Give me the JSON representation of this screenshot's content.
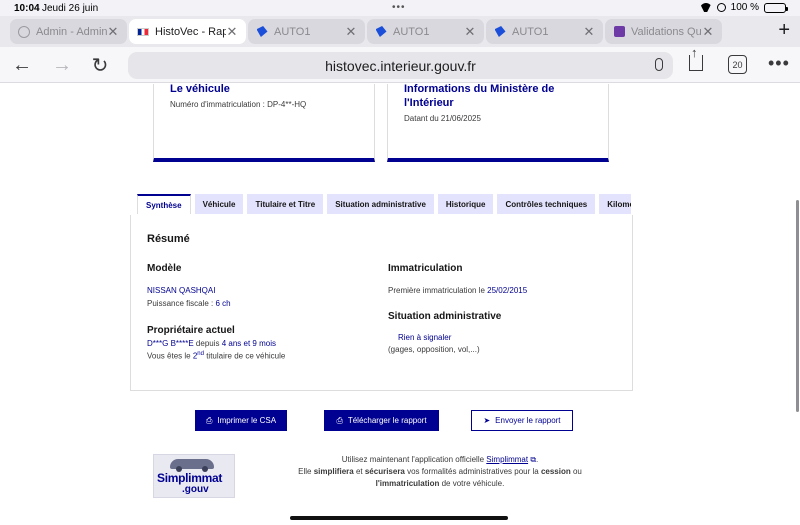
{
  "status_bar": {
    "time": "10:04",
    "date": "Jeudi 26 juin",
    "battery": "100 %"
  },
  "browser": {
    "tabs": [
      {
        "title": "Admin - Admin",
        "icon": "globe-icon",
        "active": false
      },
      {
        "title": "HistoVec - Rap",
        "icon": "french-flag-icon",
        "active": true
      },
      {
        "title": "AUTO1",
        "icon": "auto1-icon",
        "active": false
      },
      {
        "title": "AUTO1",
        "icon": "auto1-icon",
        "active": false
      },
      {
        "title": "AUTO1",
        "icon": "auto1-icon",
        "active": false
      },
      {
        "title": "Validations Qu",
        "icon": "validations-icon",
        "active": false
      }
    ],
    "url": "histovec.interieur.gouv.fr",
    "tab_count": "20"
  },
  "cards": {
    "vehicle": {
      "title": "Le véhicule",
      "line": "Numéro d'immatriculation : DP-4**-HQ"
    },
    "ministry": {
      "title_1": "Informations du Ministère de",
      "title_2": "l'Intérieur",
      "line": "Datant du 21/06/2025"
    }
  },
  "report_tabs": [
    "Synthèse",
    "Véhicule",
    "Titulaire et Titre",
    "Situation administrative",
    "Historique",
    "Contrôles techniques",
    "Kilométrage"
  ],
  "summary": {
    "heading": "Résumé",
    "modele": {
      "heading": "Modèle",
      "name": "NISSAN QASHQAI",
      "power_label": "Puissance fiscale :",
      "power_value": "6 ch"
    },
    "immatriculation": {
      "heading": "Immatriculation",
      "first_label": "Première immatriculation le",
      "first_date": "25/02/2015"
    },
    "proprietaire": {
      "heading": "Propriétaire actuel",
      "name": "D***G B****E",
      "since_label": "depuis",
      "since_value": "4 ans et 9 mois",
      "owner_prefix": "Vous êtes le",
      "owner_rank": "2",
      "owner_sup": "nd",
      "owner_suffix": "titulaire de ce véhicule"
    },
    "situation": {
      "heading": "Situation administrative",
      "status": "Rien à signaler",
      "note": "(gages, opposition, vol,...)"
    }
  },
  "actions": {
    "print": "Imprimer le CSA",
    "download": "Télécharger le rapport",
    "send": "Envoyer le rapport"
  },
  "promo": {
    "logo_text": "Simplimmat",
    "logo_suffix": ".gouv",
    "line1_pre": "Utilisez maintenant l'application officielle",
    "line1_link": "Simplimmat",
    "line2_pre": "Elle",
    "w_simplifiera": "simplifiera",
    "w_et": "et",
    "w_securisera": "sécurisera",
    "line2_mid": "vos formalités administratives pour la",
    "w_cession": "cession",
    "w_ou": "ou",
    "w_immat": "l'immatriculation",
    "line3_end": "de votre véhicule."
  }
}
